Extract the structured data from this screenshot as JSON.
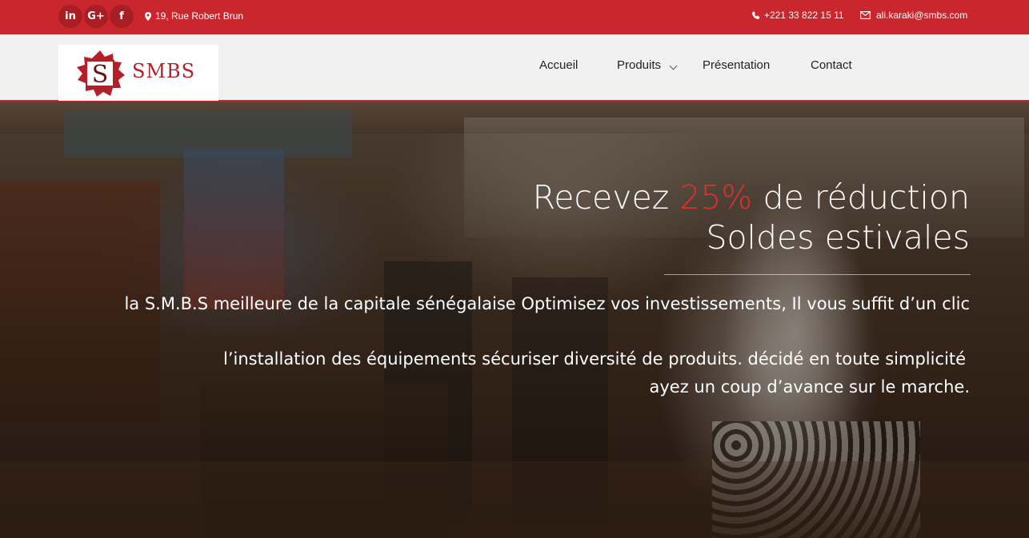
{
  "topbar": {
    "social": [
      {
        "label": "in",
        "icon": "linkedin-icon"
      },
      {
        "label": "G+",
        "icon": "google-plus-icon"
      },
      {
        "label": "f",
        "icon": "facebook-icon"
      }
    ],
    "address": "19, Rue Robert Brun",
    "phone": "+221 33 822 15 11",
    "email": "ali.karaki@smbs.com",
    "background": "#c9262e"
  },
  "header": {
    "logo_letter": "S",
    "logo_text": "SMBS",
    "nav": [
      "Accueil",
      "Produits",
      "Présentation",
      "Contact"
    ]
  },
  "hero": {
    "title_prefix": "Recevez ",
    "title_accent": "25%",
    "title_suffix": " de réduction",
    "title_line2": "Soldes estivales",
    "paragraph1": "la S.M.B.S meilleure de la capitale sénégalaise Optimisez vos investissements, Il vous suffit d’un clic",
    "paragraph2_line1": "l’installation des équipements sécuriser diversité de produits. décidé en toute simplicité",
    "paragraph2_line2": "ayez un coup d’avance sur le marche.",
    "accent_color": "#d8332d"
  }
}
